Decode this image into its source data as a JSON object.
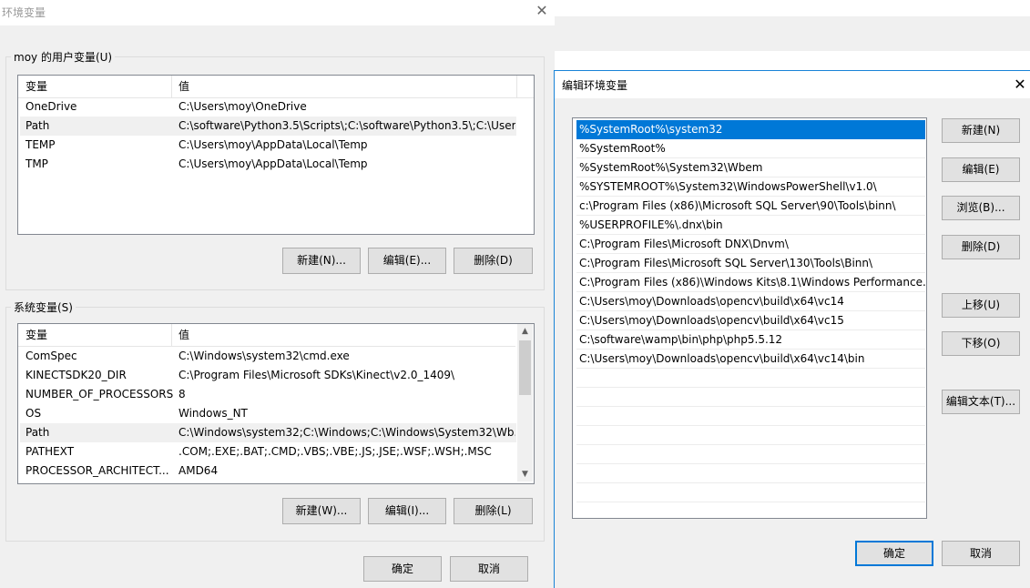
{
  "env_window": {
    "title": "环境变量",
    "user_group_label": "moy 的用户变量(U)",
    "system_group_label": "系统变量(S)",
    "columns": [
      "变量",
      "值"
    ],
    "user_vars": [
      {
        "name": "OneDrive",
        "value": "C:\\Users\\moy\\OneDrive"
      },
      {
        "name": "Path",
        "value": "C:\\software\\Python3.5\\Scripts\\;C:\\software\\Python3.5\\;C:\\User..."
      },
      {
        "name": "TEMP",
        "value": "C:\\Users\\moy\\AppData\\Local\\Temp"
      },
      {
        "name": "TMP",
        "value": "C:\\Users\\moy\\AppData\\Local\\Temp"
      }
    ],
    "system_vars": [
      {
        "name": "ComSpec",
        "value": "C:\\Windows\\system32\\cmd.exe"
      },
      {
        "name": "KINECTSDK20_DIR",
        "value": "C:\\Program Files\\Microsoft SDKs\\Kinect\\v2.0_1409\\"
      },
      {
        "name": "NUMBER_OF_PROCESSORS",
        "value": "8"
      },
      {
        "name": "OS",
        "value": "Windows_NT"
      },
      {
        "name": "Path",
        "value": "C:\\Windows\\system32;C:\\Windows;C:\\Windows\\System32\\Wb..."
      },
      {
        "name": "PATHEXT",
        "value": ".COM;.EXE;.BAT;.CMD;.VBS;.VBE;.JS;.JSE;.WSF;.WSH;.MSC"
      },
      {
        "name": "PROCESSOR_ARCHITECT...",
        "value": "AMD64"
      }
    ],
    "user_buttons": {
      "new": "新建(N)...",
      "edit": "编辑(E)...",
      "delete": "删除(D)"
    },
    "system_buttons": {
      "new": "新建(W)...",
      "edit": "编辑(I)...",
      "delete": "删除(L)"
    },
    "ok": "确定",
    "cancel": "取消"
  },
  "edit_window": {
    "title": "编辑环境变量",
    "paths": [
      "%SystemRoot%\\system32",
      "%SystemRoot%",
      "%SystemRoot%\\System32\\Wbem",
      "%SYSTEMROOT%\\System32\\WindowsPowerShell\\v1.0\\",
      "c:\\Program Files (x86)\\Microsoft SQL Server\\90\\Tools\\binn\\",
      "%USERPROFILE%\\.dnx\\bin",
      "C:\\Program Files\\Microsoft DNX\\Dnvm\\",
      "C:\\Program Files\\Microsoft SQL Server\\130\\Tools\\Binn\\",
      "C:\\Program Files (x86)\\Windows Kits\\8.1\\Windows Performance...",
      "C:\\Users\\moy\\Downloads\\opencv\\build\\x64\\vc14",
      "C:\\Users\\moy\\Downloads\\opencv\\build\\x64\\vc15",
      "C:\\software\\wamp\\bin\\php\\php5.5.12",
      "C:\\Users\\moy\\Downloads\\opencv\\build\\x64\\vc14\\bin"
    ],
    "buttons": {
      "new": "新建(N)",
      "edit": "编辑(E)",
      "browse": "浏览(B)...",
      "delete": "删除(D)",
      "move_up": "上移(U)",
      "move_down": "下移(O)",
      "edit_text": "编辑文本(T)..."
    },
    "ok": "确定",
    "cancel": "取消"
  },
  "close_glyph": "✕",
  "colors": {
    "selection": "#0078d7",
    "dialog_bg": "#f0f0f0"
  }
}
